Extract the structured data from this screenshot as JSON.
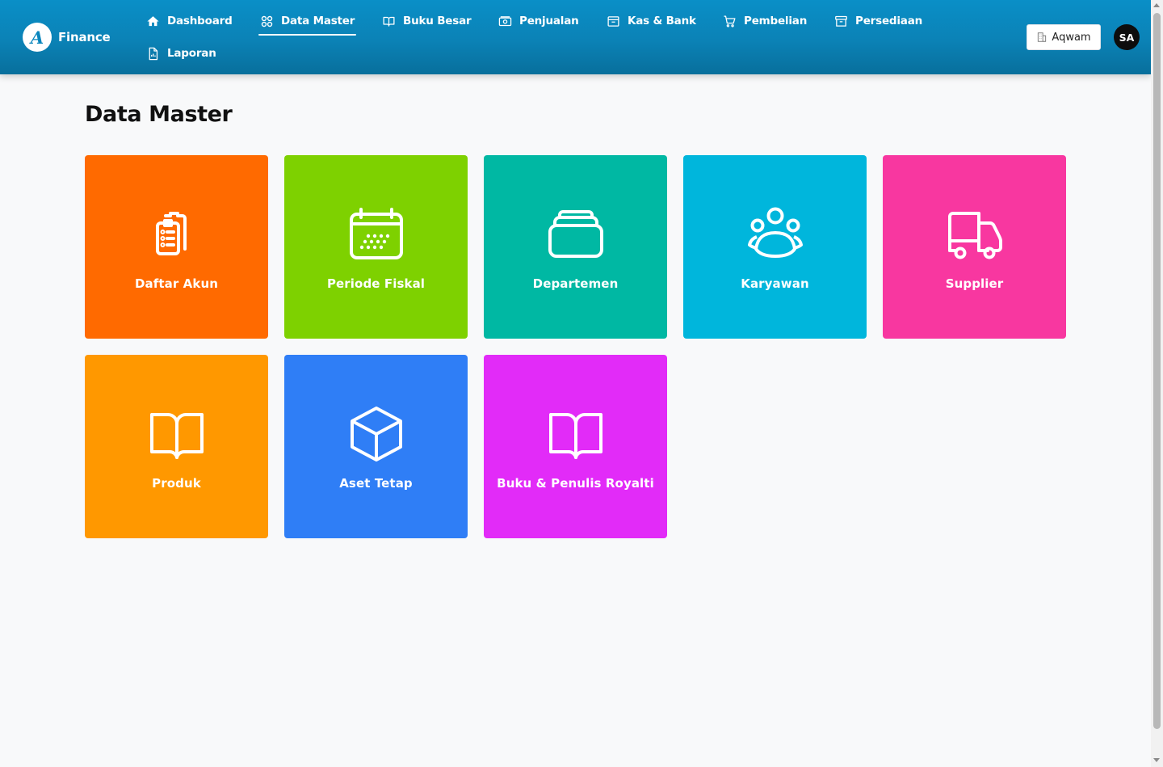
{
  "brand": {
    "logo_letter": "A",
    "name": "Finance"
  },
  "nav": {
    "items": [
      {
        "label": "Dashboard",
        "icon": "home-icon"
      },
      {
        "label": "Data Master",
        "icon": "grid-icon",
        "active": true
      },
      {
        "label": "Buku Besar",
        "icon": "book-open-icon"
      },
      {
        "label": "Penjualan",
        "icon": "cash-icon"
      },
      {
        "label": "Kas & Bank",
        "icon": "archive-box-icon"
      },
      {
        "label": "Pembelian",
        "icon": "shopping-cart-icon"
      },
      {
        "label": "Persediaan",
        "icon": "archive-icon"
      },
      {
        "label": "Laporan",
        "icon": "report-document-icon"
      }
    ]
  },
  "header": {
    "org_label": "Aqwam",
    "avatar_initials": "SA"
  },
  "main": {
    "title": "Data Master",
    "tiles": [
      {
        "label": "Daftar Akun",
        "icon": "clipboard-list-icon",
        "color": "#ff6a00"
      },
      {
        "label": "Periode Fiskal",
        "icon": "calendar-icon",
        "color": "#7ed100"
      },
      {
        "label": "Departemen",
        "icon": "inbox-stack-icon",
        "color": "#00b8a3"
      },
      {
        "label": "Karyawan",
        "icon": "users-group-icon",
        "color": "#00b6dc"
      },
      {
        "label": "Supplier",
        "icon": "truck-icon",
        "color": "#f837a0"
      },
      {
        "label": "Produk",
        "icon": "book-open-icon",
        "color": "#ff9800"
      },
      {
        "label": "Aset Tetap",
        "icon": "cube-icon",
        "color": "#2f7ef6"
      },
      {
        "label": "Buku & Penulis Royalti",
        "icon": "book-open-icon",
        "color": "#e22bf8"
      }
    ]
  }
}
